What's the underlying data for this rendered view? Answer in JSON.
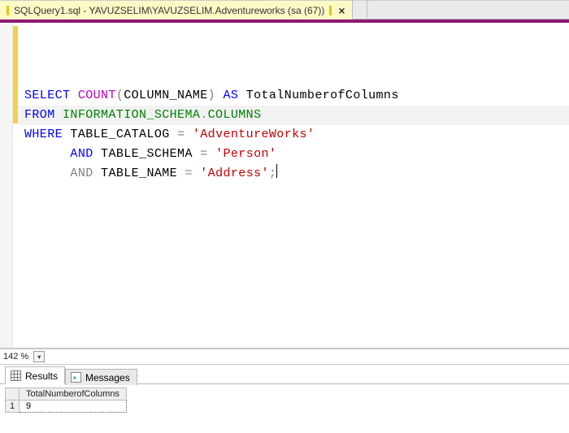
{
  "tab": {
    "title": "SQLQuery1.sql - YAVUZSELIM\\YAVUZSELIM.Adventureworks (sa (67))",
    "close_glyph": "×"
  },
  "sql": {
    "l1": {
      "select": "SELECT",
      "count": "COUNT",
      "lp": "(",
      "col": "COLUMN_NAME",
      "rp": ")",
      "as": "AS",
      "alias": "TotalNumberofColumns"
    },
    "l2": {
      "from": "FROM",
      "schema": "INFORMATION_SCHEMA",
      "dot": ".",
      "obj": "COLUMNS"
    },
    "l3": {
      "where": "WHERE",
      "col": "TABLE_CATALOG",
      "eq": "=",
      "val": "'AdventureWorks'"
    },
    "l4": {
      "and": "AND",
      "col": "TABLE_SCHEMA",
      "eq": "=",
      "val": "'Person'"
    },
    "l5": {
      "and": "AND",
      "col": "TABLE_NAME",
      "eq": "=",
      "val": "'Address'",
      "semi": ";"
    }
  },
  "zoom": {
    "value": "142 %",
    "down_glyph": "▾"
  },
  "panels": {
    "results_label": "Results",
    "messages_label": "Messages",
    "col_header": "TotalNumberofColumns",
    "rownum": "1",
    "value": "9"
  }
}
